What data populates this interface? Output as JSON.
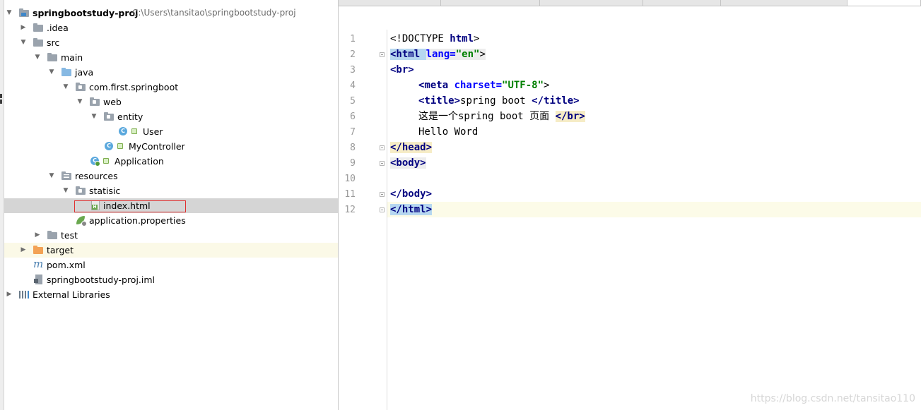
{
  "project_tree": {
    "root": {
      "name": "springbootstudy-proj",
      "path": "C:\\Users\\tansitao\\springbootstudy-proj"
    },
    "items": [
      {
        "label": ".idea"
      },
      {
        "label": "src"
      },
      {
        "label": "main"
      },
      {
        "label": "java"
      },
      {
        "label": "com.first.springboot"
      },
      {
        "label": "web"
      },
      {
        "label": "entity"
      },
      {
        "label": "User"
      },
      {
        "label": "MyController"
      },
      {
        "label": "Application"
      },
      {
        "label": "resources"
      },
      {
        "label": "statisic"
      },
      {
        "label": "index.html"
      },
      {
        "label": "application.properties"
      },
      {
        "label": "test"
      },
      {
        "label": "target"
      },
      {
        "label": "pom.xml"
      },
      {
        "label": "springbootstudy-proj.iml"
      },
      {
        "label": "External Libraries"
      }
    ],
    "class_badge": "C"
  },
  "editor": {
    "active_file": "index.html",
    "line_numbers": [
      "1",
      "2",
      "3",
      "4",
      "5",
      "6",
      "7",
      "8",
      "9",
      "10",
      "11",
      "12"
    ],
    "lines": {
      "l1": [
        "<!DOCTYPE ",
        "html",
        ">"
      ],
      "l2": [
        "<html ",
        "lang=",
        "\"en\"",
        ">"
      ],
      "l3": [
        "<br>"
      ],
      "l4": [
        "<meta ",
        "charset=",
        "\"UTF-8\"",
        ">"
      ],
      "l5": [
        "<title>",
        "spring boot ",
        "</title>"
      ],
      "l6": [
        "这是一个spring boot 页面 ",
        "</br>"
      ],
      "l7": [
        "Hello Word"
      ],
      "l8": [
        "</head>"
      ],
      "l9": [
        "<body>"
      ],
      "l10": [
        ""
      ],
      "l11": [
        "</body>"
      ],
      "l12": [
        "</html>"
      ]
    }
  },
  "watermark": "https://blog.csdn.net/tansitao110",
  "colors": {
    "selection_row": "#d5d5d5",
    "highlight_row": "#fbf9e7",
    "tag": "#000080",
    "attribute": "#0000ff",
    "value": "#008000",
    "line_number": "#999999",
    "selection_box": "#e03030"
  }
}
